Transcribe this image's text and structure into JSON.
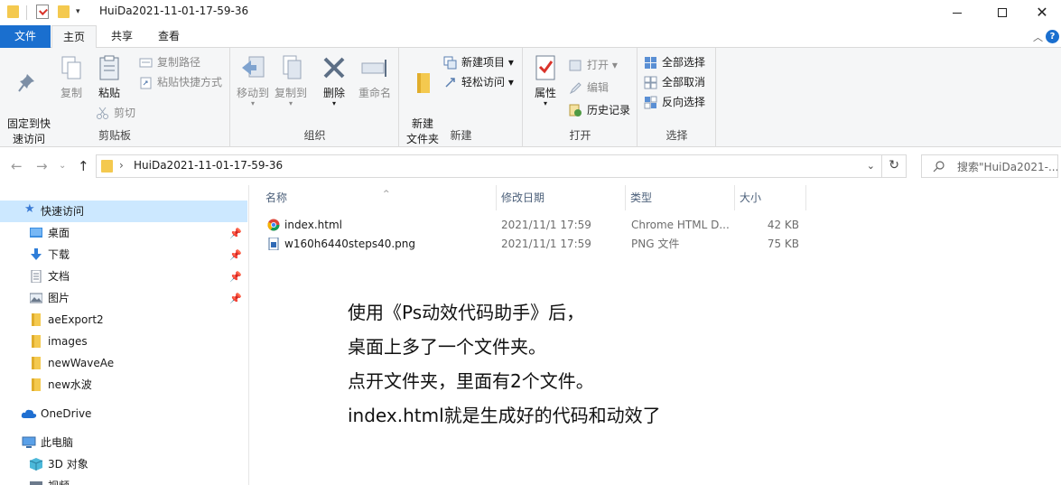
{
  "window": {
    "title": "HuiDa2021-11-01-17-59-36"
  },
  "ribbon_tabs": [
    "文件",
    "主页",
    "共享",
    "查看"
  ],
  "ribbon": {
    "clipboard": {
      "label": "剪贴板",
      "pin_quick_access": "固定到快\n速访问",
      "copy": "复制",
      "paste": "粘贴",
      "copy_path": "复制路径",
      "paste_shortcut": "粘贴快捷方式",
      "cut": "剪切"
    },
    "organize": {
      "label": "组织",
      "move_to": "移动到",
      "copy_to": "复制到",
      "delete": "删除",
      "rename": "重命名"
    },
    "new": {
      "label": "新建",
      "new_folder": "新建\n文件夹",
      "new_item": "新建项目",
      "easy_access": "轻松访问"
    },
    "open": {
      "label": "打开",
      "properties": "属性",
      "open": "打开",
      "edit": "编辑",
      "history": "历史记录"
    },
    "select": {
      "label": "选择",
      "select_all": "全部选择",
      "select_none": "全部取消",
      "invert": "反向选择"
    }
  },
  "address": {
    "path": "HuiDa2021-11-01-17-59-36",
    "search_placeholder": "搜索\"HuiDa2021-..."
  },
  "nav_pane": {
    "quick_access": "快速访问",
    "items": [
      {
        "label": "桌面",
        "icon": "desktop-icon",
        "pinned": true
      },
      {
        "label": "下载",
        "icon": "download-icon",
        "pinned": true
      },
      {
        "label": "文档",
        "icon": "document-icon",
        "pinned": true
      },
      {
        "label": "图片",
        "icon": "picture-icon",
        "pinned": true
      },
      {
        "label": "aeExport2",
        "icon": "folder-icon",
        "pinned": false
      },
      {
        "label": "images",
        "icon": "folder-icon",
        "pinned": false
      },
      {
        "label": "newWaveAe",
        "icon": "folder-icon",
        "pinned": false
      },
      {
        "label": "new水波",
        "icon": "folder-icon",
        "pinned": false
      }
    ],
    "onedrive": "OneDrive",
    "this_pc": "此电脑",
    "objects_3d": "3D 对象",
    "videos": "视频"
  },
  "columns": [
    "名称",
    "修改日期",
    "类型",
    "大小"
  ],
  "files": [
    {
      "name": "index.html",
      "modified": "2021/11/1 17:59",
      "type": "Chrome HTML D...",
      "size": "42 KB",
      "icon": "chrome-icon"
    },
    {
      "name": "w160h6440steps40.png",
      "modified": "2021/11/1 17:59",
      "type": "PNG 文件",
      "size": "75 KB",
      "icon": "png-file-icon"
    }
  ],
  "annotation": [
    "使用《Ps动效代码助手》后，",
    "桌面上多了一个文件夹。",
    "点开文件夹，里面有2个文件。",
    "index.html就是生成好的代码和动效了"
  ],
  "colors": {
    "accent": "#1a6fcf",
    "folder": "#f4c94f",
    "selected": "#cce8ff"
  }
}
